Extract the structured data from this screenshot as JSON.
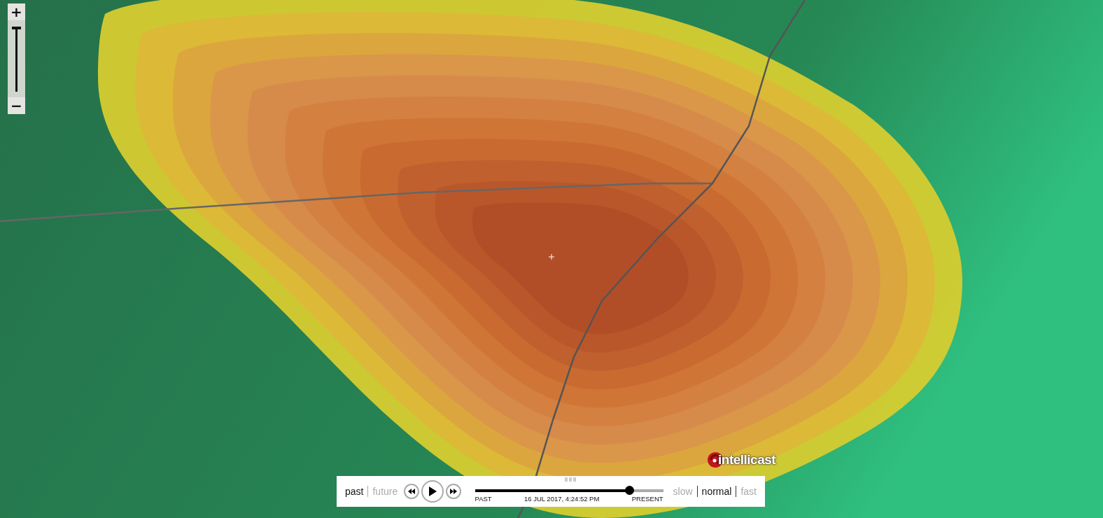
{
  "zoom": {
    "in_label": "+",
    "out_label": "−",
    "level": 0.97
  },
  "logo": {
    "text": "intellicast"
  },
  "playback": {
    "modes": [
      {
        "label": "past",
        "selected": true
      },
      {
        "label": "future",
        "selected": false
      }
    ],
    "timeline": {
      "start_label": "PAST",
      "timestamp": "16 JUL 2017, 4:24:52 PM",
      "end_label": "PRESENT",
      "level": 0.82
    },
    "speeds": [
      {
        "label": "slow",
        "selected": false
      },
      {
        "label": "normal",
        "selected": true
      },
      {
        "label": "fast",
        "selected": false
      }
    ]
  }
}
